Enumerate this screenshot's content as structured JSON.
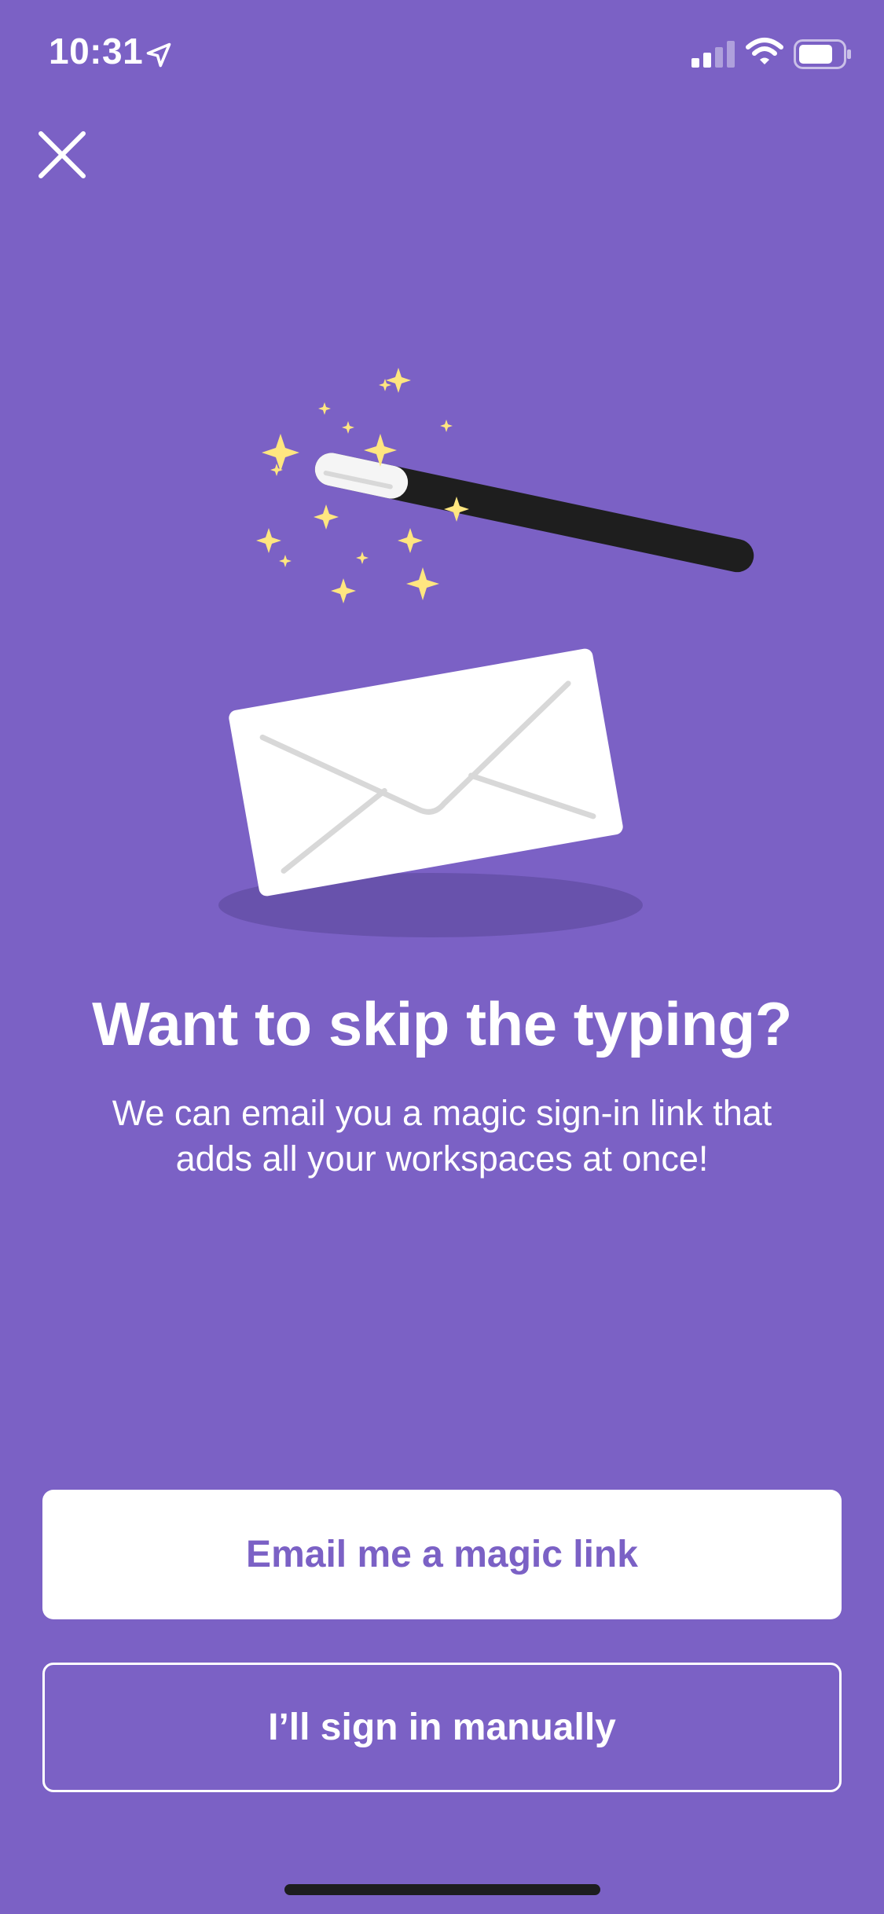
{
  "status_bar": {
    "time": "10:31"
  },
  "icons": {
    "location": "location-arrow-icon",
    "signal": "cellular-signal-icon",
    "wifi": "wifi-icon",
    "battery": "battery-icon",
    "close": "close-icon"
  },
  "onboarding": {
    "headline": "Want to skip the typing?",
    "subtext_line1": "We can email you a magic sign-in link that",
    "subtext_line2": "adds all your workspaces at once!"
  },
  "actions": {
    "primary_label": "Email me a magic link",
    "secondary_label": "I’ll sign in manually"
  },
  "colors": {
    "background": "#7B61C5",
    "primary_button_bg": "#FFFFFF",
    "primary_button_text": "#7B61C5",
    "sparkle": "#FFE680",
    "wand": "#1E1E1E",
    "shadow": "#6852AC"
  }
}
